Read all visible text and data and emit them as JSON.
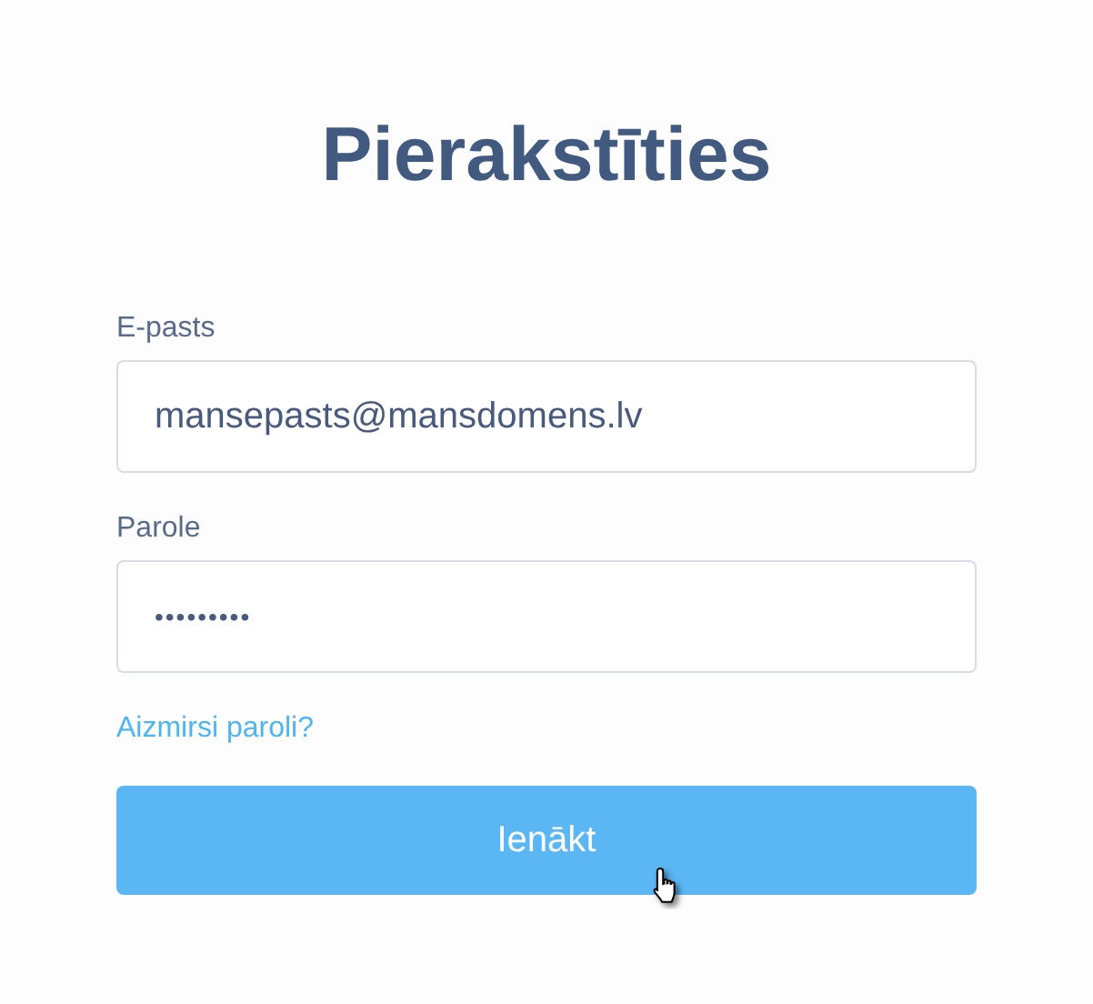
{
  "title": "Pierakstīties",
  "fields": [
    {
      "label": "E-pasts",
      "value": "mansepasts@mansdomens.lv",
      "kind": "text"
    },
    {
      "label": "Parole",
      "value": "•••••••••",
      "kind": "password"
    }
  ],
  "forgot_link": "Aizmirsi paroli?",
  "submit_button": "Ienākt"
}
